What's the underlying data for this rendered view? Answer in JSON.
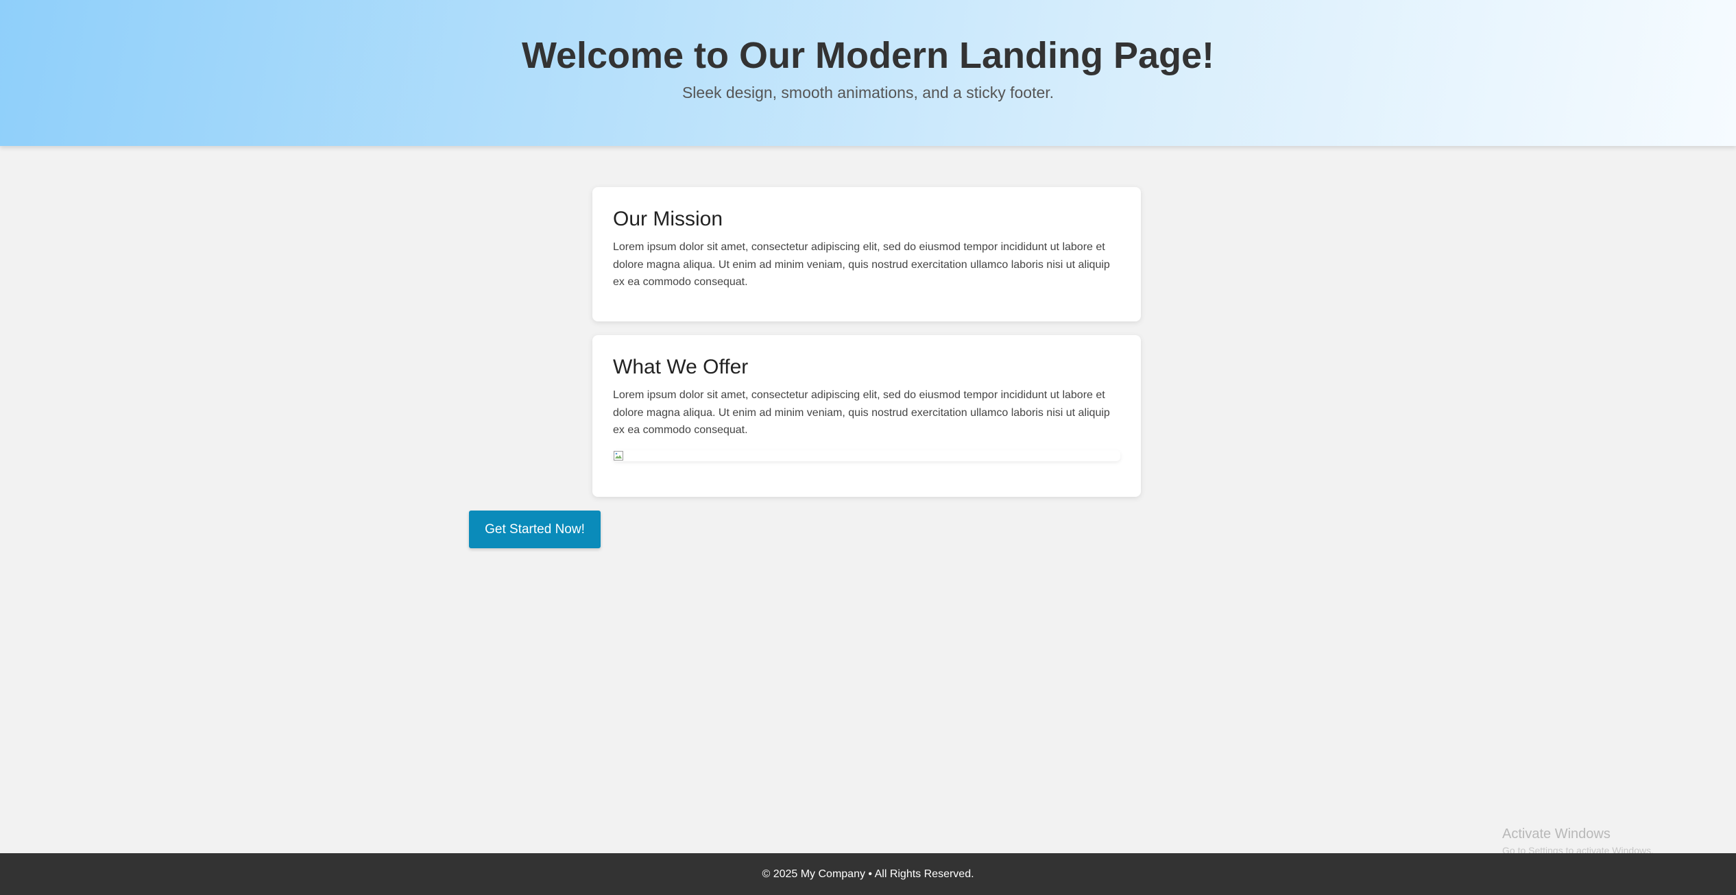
{
  "hero": {
    "title": "Welcome to Our Modern Landing Page!",
    "subtitle": "Sleek design, smooth animations, and a sticky footer."
  },
  "cards": [
    {
      "title": "Our Mission",
      "body": "Lorem ipsum dolor sit amet, consectetur adipiscing elit, sed do eiusmod tempor incididunt ut labore et dolore magna aliqua. Ut enim ad minim veniam, quis nostrud exercitation ullamco laboris nisi ut aliquip ex ea commodo consequat."
    },
    {
      "title": "What We Offer",
      "body": "Lorem ipsum dolor sit amet, consectetur adipiscing elit, sed do eiusmod tempor incididunt ut labore et dolore magna aliqua. Ut enim ad minim veniam, quis nostrud exercitation ullamco laboris nisi ut aliquip ex ea commodo consequat.",
      "image_icon": "broken-image-icon"
    }
  ],
  "cta": {
    "label": "Get Started Now!"
  },
  "footer": {
    "text": "© 2025 My Company • All Rights Reserved."
  },
  "os_watermark": {
    "title": "Activate Windows",
    "subtitle": "Go to Settings to activate Windows."
  },
  "colors": {
    "hero_gradient_start": "#8fcffa",
    "hero_gradient_end": "#f6fbff",
    "page_background": "#f2f2f2",
    "cta_background": "#0a8bba",
    "footer_background": "#333333"
  }
}
